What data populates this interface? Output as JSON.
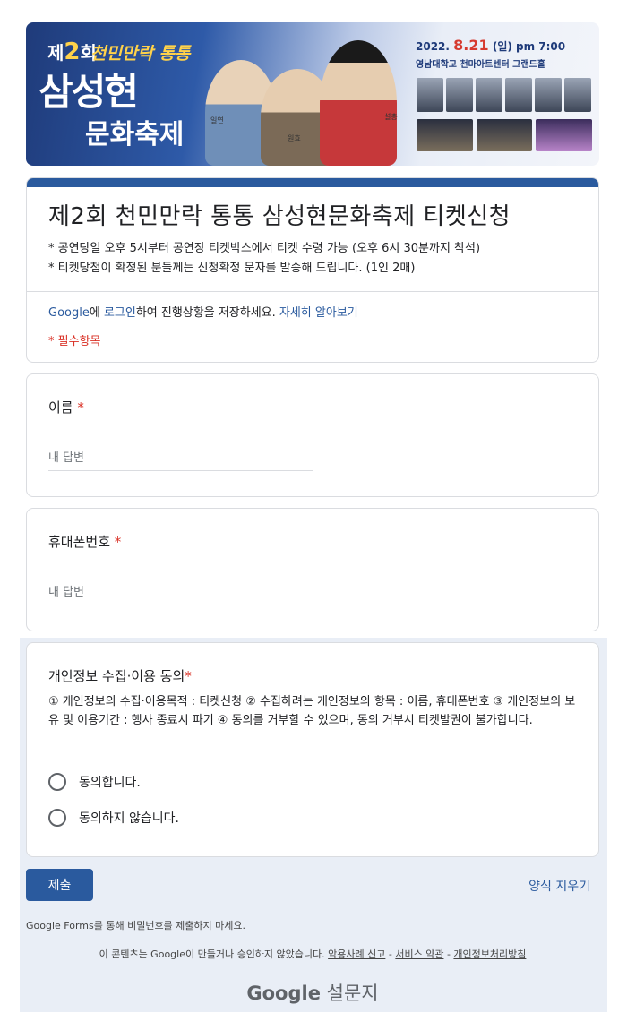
{
  "banner": {
    "edition_num": "2",
    "edition_suffix": "회",
    "festival_theme": "천민만락 통통",
    "festival_name": "삼성현",
    "festival_name2": "문화축제",
    "figure_labels": [
      "일연",
      "원효",
      "설총"
    ],
    "date_prefix": "2022.",
    "date_day": "8.21",
    "date_suffix": "(일) pm 7:00",
    "venue": "영남대학교 천마아트센터 그랜드홀"
  },
  "form": {
    "title": "제2회 천민만락 통통 삼성현문화축제 티켓신청",
    "description_lines": [
      "* 공연당일 오후 5시부터 공연장 티켓박스에서 티켓 수령 가능 (오후 6시 30분까지 착석)",
      "* 티켓당첨이 확정된 분들께는 신청확정 문자를 발송해 드립니다. (1인 2매)"
    ],
    "login": {
      "google_link": "Google",
      "text1": "에 ",
      "login_link": "로그인",
      "text2": "하여 진행상황을 저장하세요. ",
      "learn_more": "자세히 알아보기"
    },
    "required_note": "* 필수항목"
  },
  "questions": {
    "name": {
      "label": "이름",
      "required_mark": "*",
      "placeholder": "내 답변"
    },
    "phone": {
      "label": "휴대폰번호",
      "required_mark": "*",
      "placeholder": "내 답변"
    },
    "consent": {
      "label": "개인정보 수집·이용 동의",
      "required_mark": "*",
      "text": "① 개인정보의 수집·이용목적 : 티켓신청 ② 수집하려는 개인정보의 항목 : 이름, 휴대폰번호 ③ 개인정보의 보유 및 이용기간 : 행사 종료시 파기 ④ 동의를 거부할 수 있으며, 동의 거부시 티켓발권이 불가합니다.",
      "options": [
        "동의합니다.",
        "동의하지 않습니다."
      ]
    }
  },
  "actions": {
    "submit": "제출",
    "clear": "양식 지우기"
  },
  "footer": {
    "password_warning": "Google Forms를 통해 비밀번호를 제출하지 마세요.",
    "disclaimer": "이 콘텐츠는 Google이 만들거나 승인하지 않았습니다.",
    "report_abuse": "악용사례 신고",
    "terms": "서비스 약관",
    "privacy": "개인정보처리방침",
    "separator": " - ",
    "logo_google": "Google",
    "logo_product": "설문지"
  },
  "colors": {
    "accent": "#2a5a9e",
    "required": "#d93025",
    "background": "#e9eef6"
  }
}
